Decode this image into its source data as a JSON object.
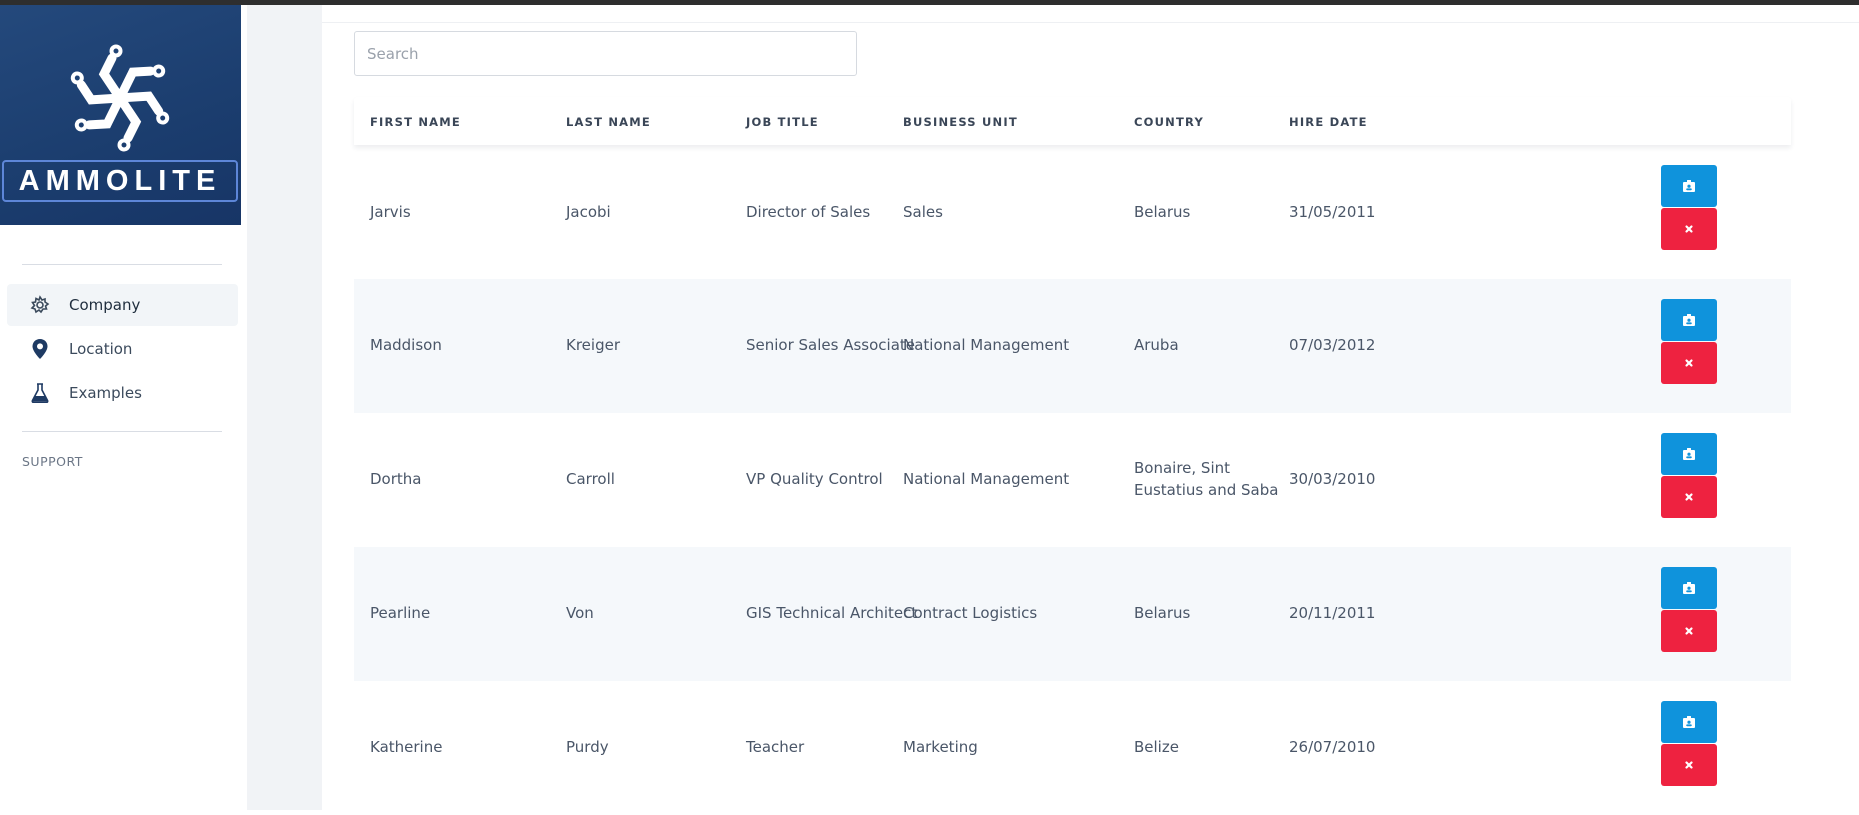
{
  "brand": {
    "name": "AMMOLITE"
  },
  "sidebar": {
    "items": [
      {
        "label": "Company",
        "icon": "company-icon",
        "active": true
      },
      {
        "label": "Location",
        "icon": "location-pin-icon",
        "active": false
      },
      {
        "label": "Examples",
        "icon": "flask-icon",
        "active": false
      }
    ],
    "section_label": "SUPPORT"
  },
  "search": {
    "placeholder": "Search",
    "value": ""
  },
  "table": {
    "columns": [
      "FIRST NAME",
      "LAST NAME",
      "JOB TITLE",
      "BUSINESS UNIT",
      "COUNTRY",
      "HIRE DATE"
    ],
    "rows": [
      {
        "first_name": "Jarvis",
        "last_name": "Jacobi",
        "job_title": "Director of Sales",
        "business_unit": "Sales",
        "country": "Belarus",
        "hire_date": "31/05/2011"
      },
      {
        "first_name": "Maddison",
        "last_name": "Kreiger",
        "job_title": "Senior Sales Associate",
        "business_unit": "National Management",
        "country": "Aruba",
        "hire_date": "07/03/2012"
      },
      {
        "first_name": "Dortha",
        "last_name": "Carroll",
        "job_title": "VP Quality Control",
        "business_unit": "National Management",
        "country": "Bonaire, Sint Eustatius and Saba",
        "hire_date": "30/03/2010"
      },
      {
        "first_name": "Pearline",
        "last_name": "Von",
        "job_title": "GIS Technical Architect",
        "business_unit": "Contract Logistics",
        "country": "Belarus",
        "hire_date": "20/11/2011"
      },
      {
        "first_name": "Katherine",
        "last_name": "Purdy",
        "job_title": "Teacher",
        "business_unit": "Marketing",
        "country": "Belize",
        "hire_date": "26/07/2010"
      }
    ],
    "row_actions": [
      {
        "name": "edit",
        "icon": "id-card-icon",
        "color": "#0f93dc"
      },
      {
        "name": "delete",
        "icon": "close-icon",
        "color": "#ee2240"
      }
    ]
  },
  "colors": {
    "sidebar_logo_bg": "#1b3d6e",
    "primary": "#0f93dc",
    "danger": "#ee2240",
    "page_bg": "#f1f3f6"
  }
}
